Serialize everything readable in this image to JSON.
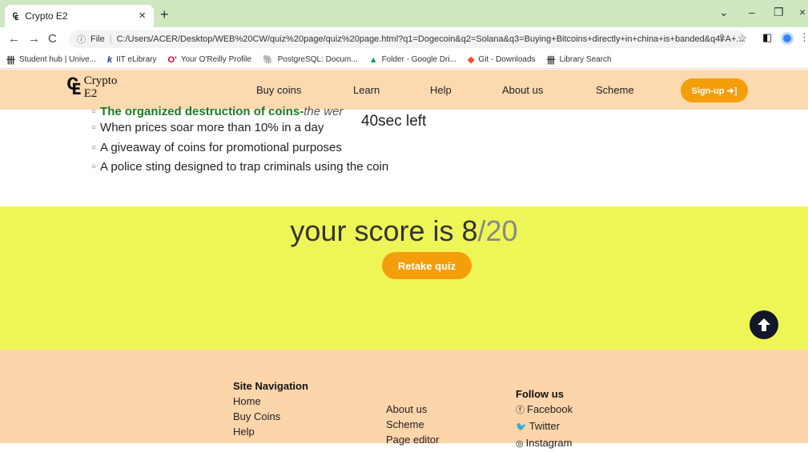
{
  "browser": {
    "tab_title": "Crypto E2",
    "tab_icon": "crypto-e2-logo",
    "address": {
      "scheme_label": "File",
      "url": "C:/Users/ACER/Desktop/WEB%20CW/quiz%20page/quiz%20page.html?q1=Dogecoin&q2=Solana&q3=Buying+Bitcoins+directly+in+china+is+banded&q4=A+..."
    },
    "bookmarks": [
      {
        "icon": "library-icon",
        "label": "Student hub | Unive..."
      },
      {
        "icon": "k-icon",
        "label": "IIT eLibrary"
      },
      {
        "icon": "oreilly-icon",
        "label": "Your O'Reilly Profile"
      },
      {
        "icon": "postgres-icon",
        "label": "PostgreSQL: Docum..."
      },
      {
        "icon": "drive-icon",
        "label": "Folder - Google Dri..."
      },
      {
        "icon": "git-icon",
        "label": "Git - Downloads"
      },
      {
        "icon": "library-icon",
        "label": "Library Search"
      }
    ]
  },
  "header": {
    "logo_line1": "Crypto",
    "logo_line2": "E2",
    "nav": [
      "Buy coins",
      "Learn",
      "Help",
      "About us",
      "Scheme"
    ],
    "signup_label": "Sign-up ➜]"
  },
  "quiz": {
    "first_option_bold": "The organized destruction of coins-",
    "first_option_tail": "the                wer",
    "options": [
      "When prices soar more than 10% in a day",
      "A giveaway of coins for promotional purposes",
      "A police sting designed to trap criminals using the coin"
    ],
    "timer": "40sec left"
  },
  "score": {
    "prefix": "your score is ",
    "value": "8",
    "total": "/20",
    "retake_label": "Retake quiz"
  },
  "footer": {
    "nav_heading": "Site Navigation",
    "nav_col1": [
      "Home",
      "Buy Coins",
      "Help"
    ],
    "nav_col2": [
      "About us",
      "Scheme",
      "Page editor"
    ],
    "follow_heading": "Follow us",
    "social": [
      {
        "icon": "facebook-icon",
        "label": "Facebook"
      },
      {
        "icon": "twitter-icon",
        "label": "Twitter"
      },
      {
        "icon": "instagram-icon",
        "label": "Instagram"
      }
    ]
  },
  "colors": {
    "header_bg": "#fdd9b0",
    "accent": "#f59e0b",
    "score_bg": "#eef556",
    "footer_bg": "#fdd5ab",
    "correct_green": "#1d7a28"
  }
}
